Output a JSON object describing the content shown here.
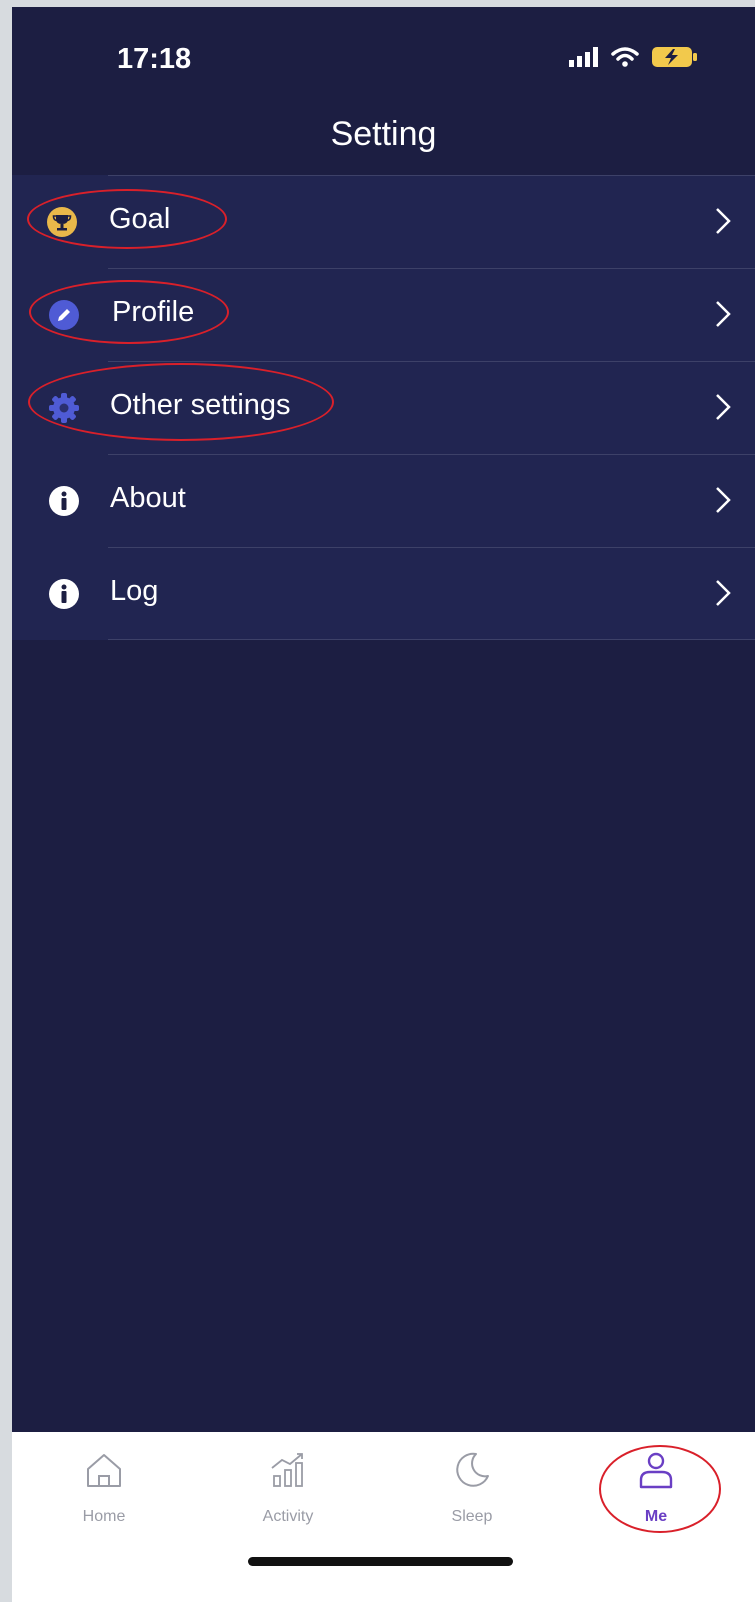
{
  "status_bar": {
    "time": "17:18",
    "icons": [
      "signal-icon",
      "wifi-icon",
      "battery-charging-icon"
    ]
  },
  "header": {
    "title": "Setting"
  },
  "menu": {
    "items": [
      {
        "label": "Goal",
        "icon": "trophy-icon",
        "icon_color": "#e9b84a"
      },
      {
        "label": "Profile",
        "icon": "pencil-icon",
        "icon_color": "#4f5bd5"
      },
      {
        "label": "Other settings",
        "icon": "gear-icon",
        "icon_color": "#4f5bd5"
      },
      {
        "label": "About",
        "icon": "info-icon",
        "icon_color": "#ffffff"
      },
      {
        "label": "Log",
        "icon": "info-icon",
        "icon_color": "#ffffff"
      }
    ]
  },
  "tab_bar": {
    "tabs": [
      {
        "label": "Home",
        "icon": "home-icon"
      },
      {
        "label": "Activity",
        "icon": "activity-chart-icon"
      },
      {
        "label": "Sleep",
        "icon": "moon-icon"
      },
      {
        "label": "Me",
        "icon": "user-icon",
        "active": true
      }
    ]
  },
  "colors": {
    "background": "#1c1e42",
    "menu_background": "#212551",
    "accent": "#6a3fc4",
    "annotation": "#d9202a",
    "battery": "#f2c94c"
  }
}
